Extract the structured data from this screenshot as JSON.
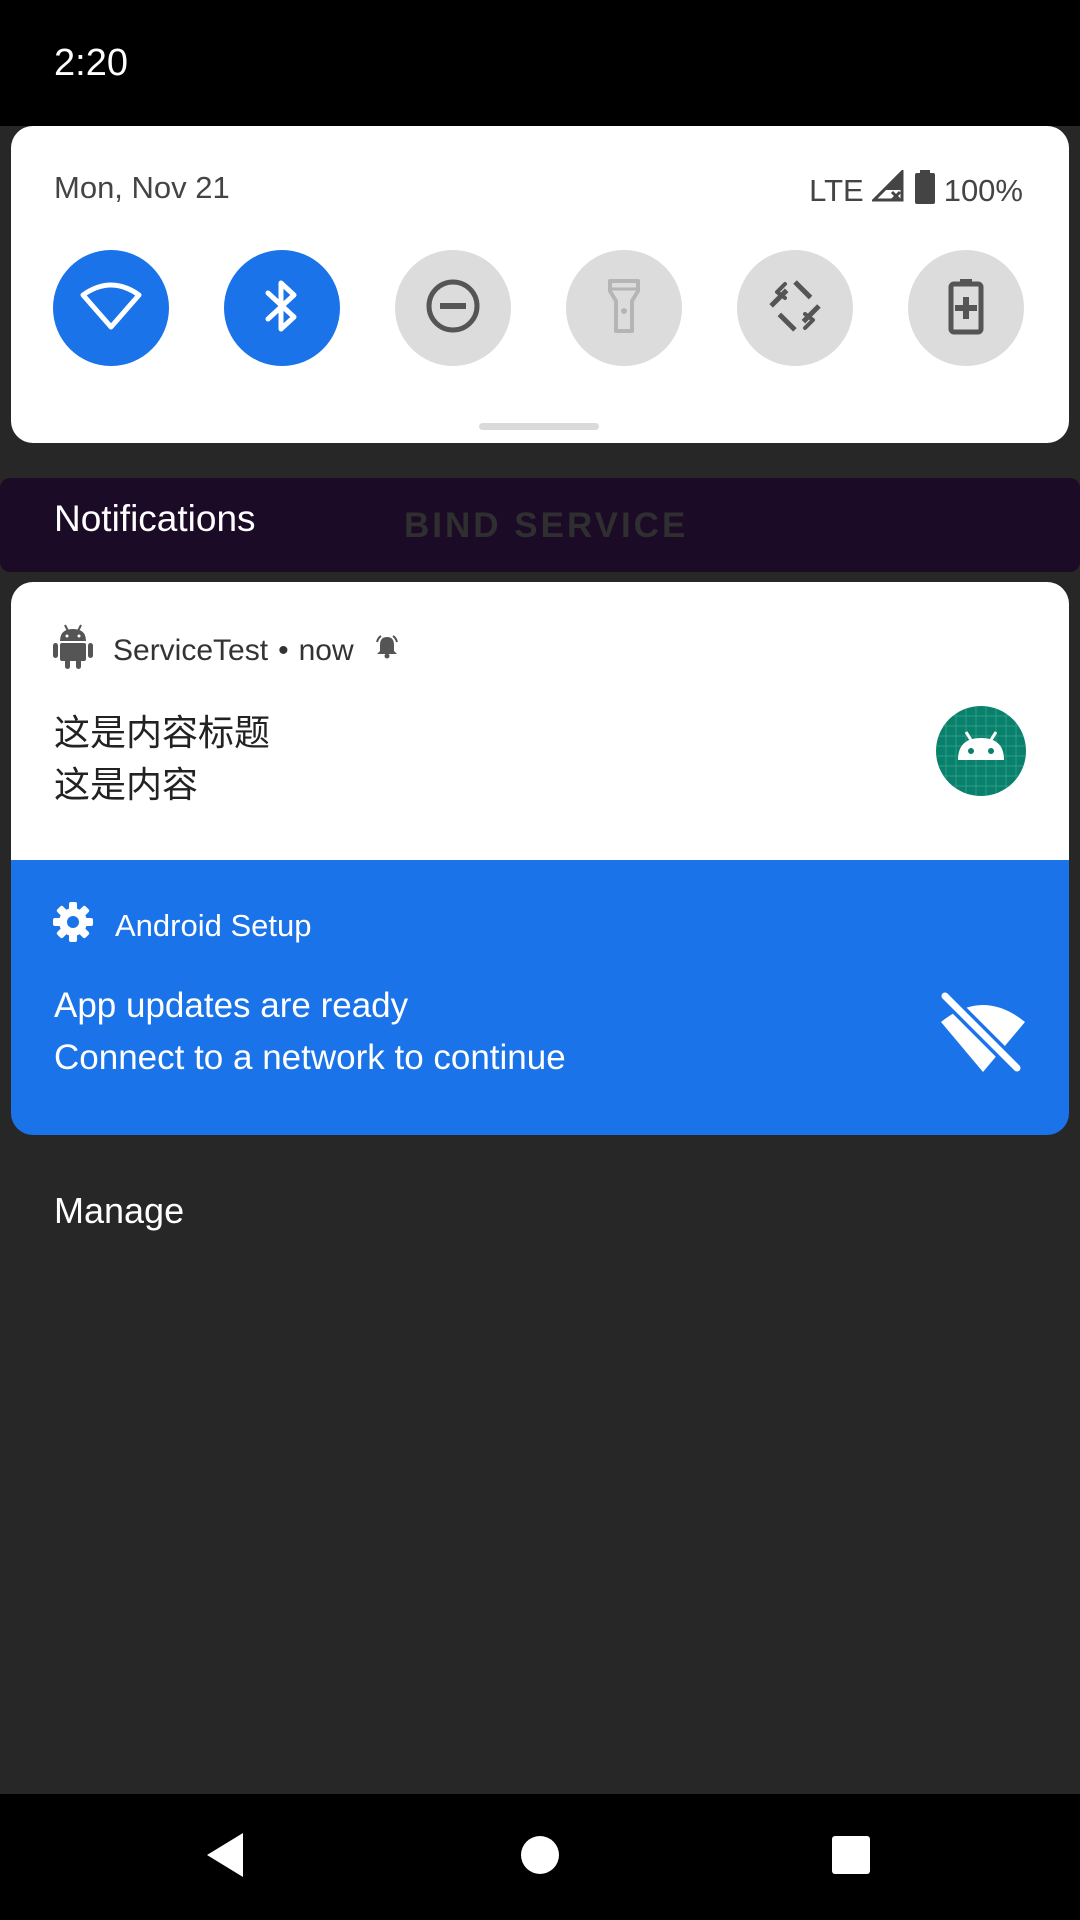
{
  "status_bar": {
    "time": "2:20"
  },
  "quick_settings": {
    "date": "Mon, Nov 21",
    "network_type": "LTE",
    "battery_percent": "100%",
    "tiles": [
      {
        "id": "wifi",
        "icon": "wifi-icon",
        "state": "on"
      },
      {
        "id": "bluetooth",
        "icon": "bluetooth-icon",
        "state": "on"
      },
      {
        "id": "do-not-disturb",
        "icon": "do-not-disturb-icon",
        "state": "off"
      },
      {
        "id": "flashlight",
        "icon": "flashlight-icon",
        "state": "off"
      },
      {
        "id": "auto-rotate",
        "icon": "auto-rotate-icon",
        "state": "off"
      },
      {
        "id": "battery-saver",
        "icon": "battery-saver-icon",
        "state": "off"
      }
    ]
  },
  "notifications_header": {
    "title": "Notifications",
    "background_button": "BIND SERVICE"
  },
  "notifications": [
    {
      "app_name": "ServiceTest",
      "separator": "•",
      "time": "now",
      "title": "这是内容标题",
      "text": "这是内容",
      "app_icon": "android-robot-icon",
      "alert_icon": "bell-icon",
      "large_icon": "android-launcher-icon"
    },
    {
      "app_name": "Android Setup",
      "title": "App updates are ready",
      "text": "Connect to a network to continue",
      "app_icon": "gear-icon",
      "large_icon": "wifi-off-icon",
      "background_color": "#1a73e8"
    }
  ],
  "footer": {
    "manage_label": "Manage"
  },
  "nav_bar": {
    "buttons": [
      "back-icon",
      "home-icon",
      "recents-icon"
    ]
  },
  "colors": {
    "accent": "#1a73e8",
    "scrim": "#272727",
    "header_bg": "#1c0b27"
  }
}
